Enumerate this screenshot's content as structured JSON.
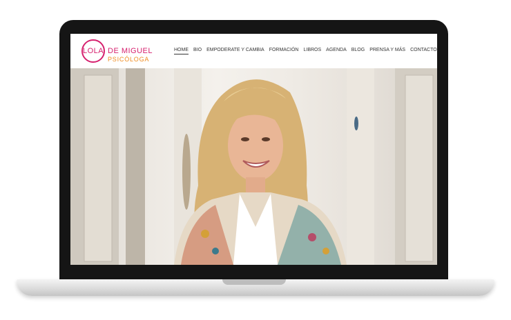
{
  "logo": {
    "lola": "LOLA",
    "de_miguel": "DE MIGUEL",
    "psicologa": "PSICÓLOGA"
  },
  "nav": {
    "items": [
      {
        "label": "HOME",
        "active": true
      },
      {
        "label": "BIO"
      },
      {
        "label": "EMPODERATE Y CAMBIA"
      },
      {
        "label": "FORMACIÓN"
      },
      {
        "label": "LIBROS"
      },
      {
        "label": "AGENDA"
      },
      {
        "label": "BLOG"
      },
      {
        "label": "PRENSA Y MÁS"
      },
      {
        "label": "CONTACTO"
      }
    ]
  },
  "colors": {
    "brand_pink": "#d6206e",
    "brand_orange": "#f08a1c",
    "laptop_bezel": "#151515"
  }
}
